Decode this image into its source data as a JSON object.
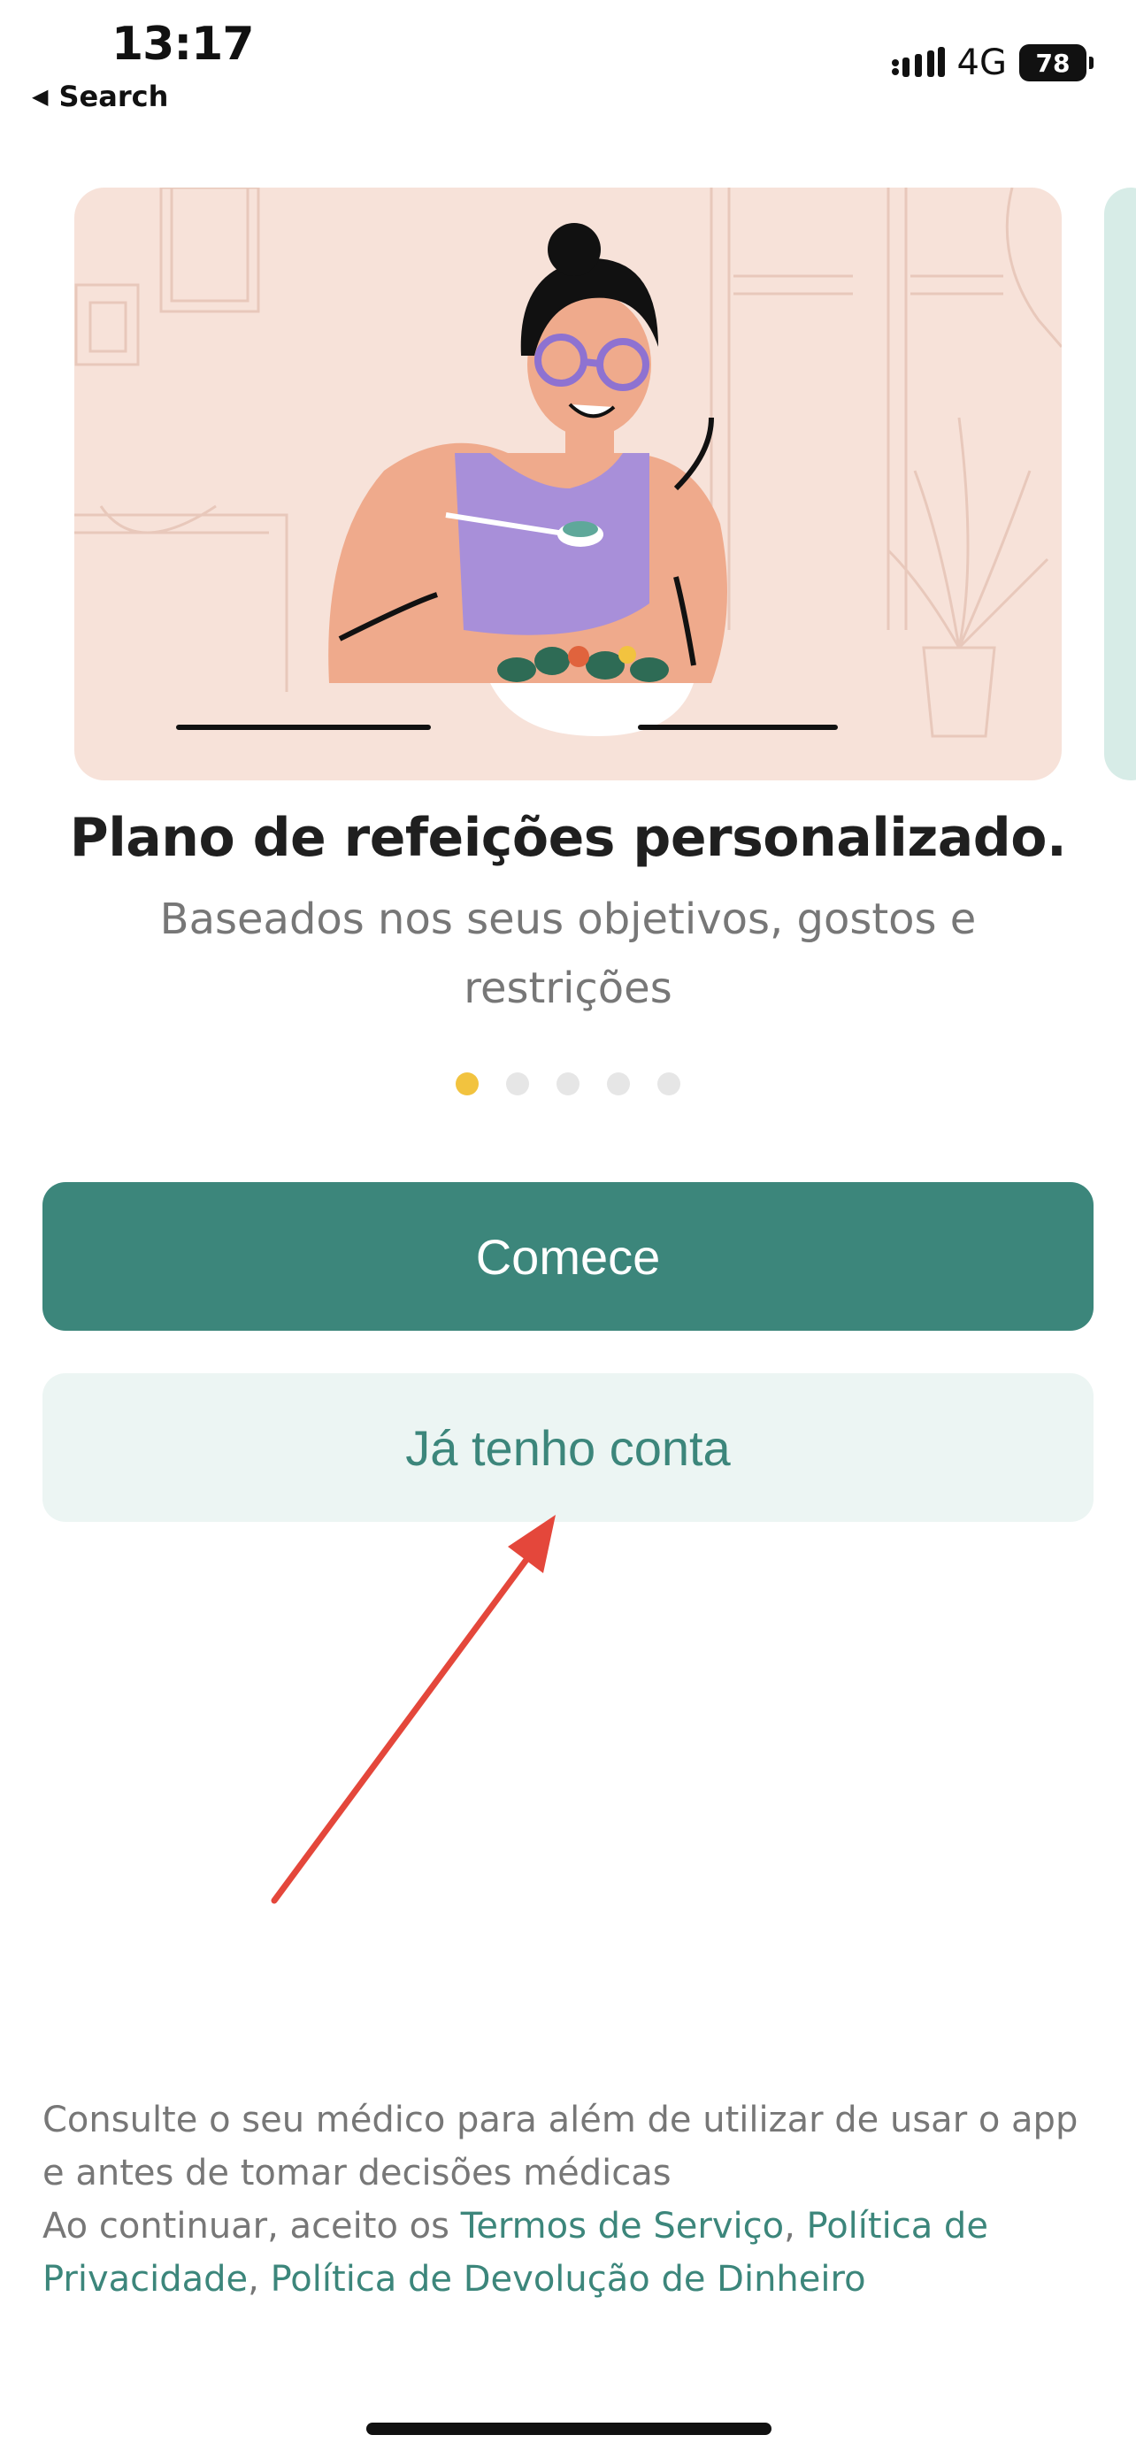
{
  "status_bar": {
    "time": "13:17",
    "back_label": "Search",
    "network": "4G",
    "battery": "78"
  },
  "carousel": {
    "title": "Plano de refeições personalizado.",
    "subtitle": "Baseados nos seus objetivos, gostos e restrições",
    "page_count": 5,
    "active_index": 0,
    "colors": {
      "active_dot": "#f2c33f",
      "inactive_dot": "#e6e6e6",
      "card_bg": "#f7e2d9"
    }
  },
  "buttons": {
    "primary_label": "Comece",
    "secondary_label": "Já tenho conta"
  },
  "footer": {
    "disclaimer": "Consulte o seu médico para além de utilizar de usar o app e antes de tomar decisões médicas",
    "consent_prefix": "Ao continuar, aceito os ",
    "terms_link": "Termos de Serviço",
    "privacy_link": "Política de Privacidade",
    "refund_link": "Política de Devolução de Dinheiro",
    "separator": ", "
  },
  "theme": {
    "brand_green": "#3c867b",
    "annotation_red": "#e4473b"
  }
}
